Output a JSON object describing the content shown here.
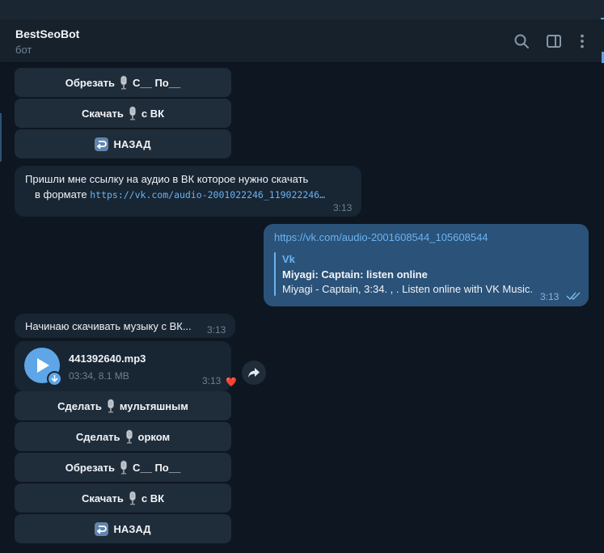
{
  "header": {
    "title": "BestSeoBot",
    "subtitle": "бот",
    "icons": [
      "search-icon",
      "sidebar-toggle-icon",
      "more-vert-icon"
    ]
  },
  "keyboard_top": {
    "trim": [
      "Обрезать",
      "С__ По__"
    ],
    "download": [
      "Скачать",
      "с ВК"
    ],
    "back": "НАЗАД"
  },
  "messages": {
    "request_link": {
      "line1": "Пришли мне ссылку на аудио в ВК которое нужно скачать",
      "line2_prefix": "в формате ",
      "line2_code": "https://vk.com/audio-2001022246_119022246…",
      "time": "3:13"
    },
    "user_link": {
      "url": "https://vk.com/audio-2001608544_105608544",
      "preview_site": "Vk",
      "preview_title": "Miyagi: Captain: listen online",
      "preview_desc": "Miyagi - Captain, 3:34. , . Listen online with VK Music.",
      "time": "3:13"
    },
    "start_download": {
      "text": "Начинаю скачивать музыку с ВК...",
      "time": "3:13"
    },
    "audio": {
      "filename": "441392640.mp3",
      "meta": "03:34, 8.1 MB",
      "time": "3:13",
      "reaction": "❤️"
    }
  },
  "keyboard_bottom": {
    "cartoon": [
      "Сделать",
      "мультяшным"
    ],
    "orc": [
      "Сделать",
      "орком"
    ],
    "trim": [
      "Обрезать",
      "С__ По__"
    ],
    "download": [
      "Скачать",
      "с ВК"
    ],
    "back": "НАЗАД"
  },
  "colors": {
    "background": "#0e1621",
    "header": "#17212b",
    "incoming": "#182533",
    "outgoing": "#2b5278",
    "button": "#1f2c3a",
    "accent": "#5ea6e8",
    "link": "#6ab3f3"
  }
}
